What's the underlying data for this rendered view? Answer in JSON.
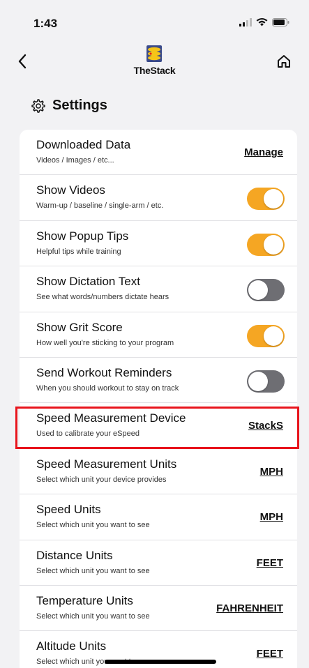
{
  "status_bar": {
    "time": "1:43"
  },
  "app": {
    "title": "TheStack"
  },
  "section": {
    "title": "Settings"
  },
  "rows": [
    {
      "title": "Downloaded Data",
      "subtitle": "Videos / Images / etc...",
      "kind": "link",
      "value": "Manage"
    },
    {
      "title": "Show Videos",
      "subtitle": "Warm-up / baseline / single-arm / etc.",
      "kind": "toggle",
      "on": true
    },
    {
      "title": "Show Popup Tips",
      "subtitle": "Helpful tips while training",
      "kind": "toggle",
      "on": true
    },
    {
      "title": "Show Dictation Text",
      "subtitle": "See what words/numbers dictate hears",
      "kind": "toggle",
      "on": false
    },
    {
      "title": "Show Grit Score",
      "subtitle": "How well you're sticking to your program",
      "kind": "toggle",
      "on": true
    },
    {
      "title": "Send Workout Reminders",
      "subtitle": "When you should workout to stay on track",
      "kind": "toggle",
      "on": false
    },
    {
      "title": "Speed Measurement Device",
      "subtitle": "Used to calibrate your eSpeed",
      "kind": "link",
      "value": "StackS"
    },
    {
      "title": "Speed Measurement Units",
      "subtitle": "Select which unit your device provides",
      "kind": "link",
      "value": "MPH"
    },
    {
      "title": "Speed Units",
      "subtitle": "Select which unit you want to see",
      "kind": "link",
      "value": "MPH"
    },
    {
      "title": "Distance Units",
      "subtitle": "Select which unit you want to see",
      "kind": "link",
      "value": "FEET"
    },
    {
      "title": "Temperature Units",
      "subtitle": "Select which unit you want to see",
      "kind": "link",
      "value": "FAHRENHEIT"
    },
    {
      "title": "Altitude Units",
      "subtitle": "Select which unit you want to see",
      "kind": "link",
      "value": "FEET"
    }
  ],
  "colors": {
    "accent": "#f5a623",
    "toggle_off": "#6e6e73",
    "highlight": "#e8141c",
    "background": "#f2f2f4"
  },
  "icons": {
    "back": "chevron-left-icon",
    "home": "home-icon",
    "settings": "gear-icon",
    "logo": "stack-logo-icon"
  }
}
